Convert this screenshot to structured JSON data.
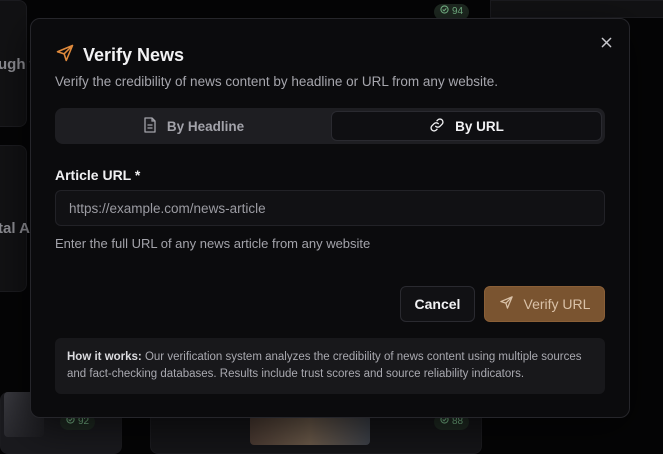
{
  "background": {
    "card1_text": "ugh t",
    "card2_text": "tal A",
    "badges": [
      "94",
      "92",
      "88"
    ]
  },
  "modal": {
    "title": "Verify News",
    "subtitle": "Verify the credibility of news content by headline or URL from any website.",
    "tabs": [
      {
        "label": "By Headline",
        "icon": "document-icon",
        "active": false
      },
      {
        "label": "By URL",
        "icon": "link-icon",
        "active": true
      }
    ],
    "field": {
      "label": "Article URL *",
      "value": "",
      "placeholder": "https://example.com/news-article",
      "hint": "Enter the full URL of any news article from any website"
    },
    "buttons": {
      "cancel": "Cancel",
      "verify": "Verify URL"
    },
    "info": {
      "heading": "How it works:",
      "text": " Our verification system analyzes the credibility of news content using multiple sources and fact-checking databases. Results include trust scores and source reliability indicators."
    }
  },
  "colors": {
    "accent": "#e08a3c",
    "verify_bg": "#7a5430",
    "badge_green": "#79b98a"
  }
}
